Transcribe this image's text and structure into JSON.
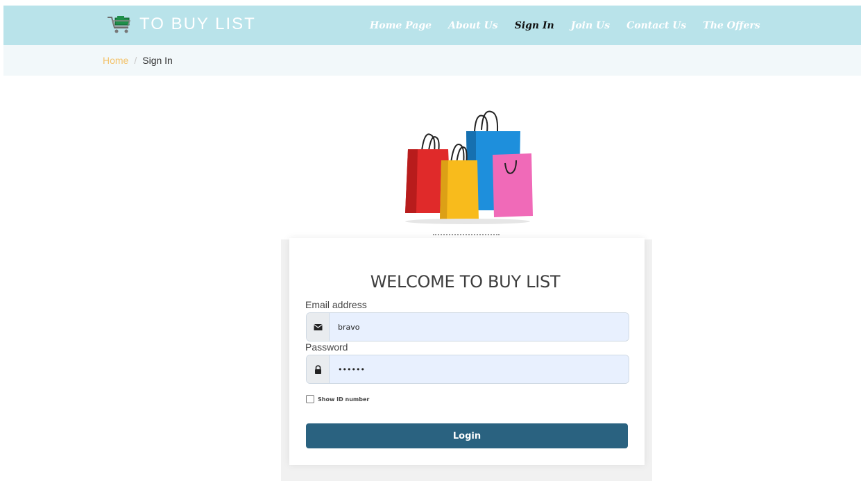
{
  "brand": {
    "name": "TO BUY LIST",
    "icon": "shopping-cart-icon"
  },
  "nav": [
    {
      "label": "Home Page",
      "active": false
    },
    {
      "label": "About Us",
      "active": false
    },
    {
      "label": "Sign In",
      "active": true
    },
    {
      "label": "Join Us",
      "active": false
    },
    {
      "label": "Contact Us",
      "active": false
    },
    {
      "label": "The Offers",
      "active": false
    }
  ],
  "breadcrumb": {
    "home": "Home",
    "separator": "/",
    "current": "Sign In"
  },
  "form": {
    "title": "WELCOME TO BUY LIST",
    "email_label": "Email address",
    "email_value": "bravo",
    "password_label": "Password",
    "password_value": "••••••",
    "show_id_label": "Show ID number",
    "show_id_checked": false,
    "login_label": "Login"
  },
  "colors": {
    "navbar_bg": "#b9e3ea",
    "breadcrumb_bg": "#f2f8fa",
    "breadcrumb_home": "#f3c26a",
    "button_bg": "#2a6280",
    "input_bg": "#e8f0fe"
  }
}
